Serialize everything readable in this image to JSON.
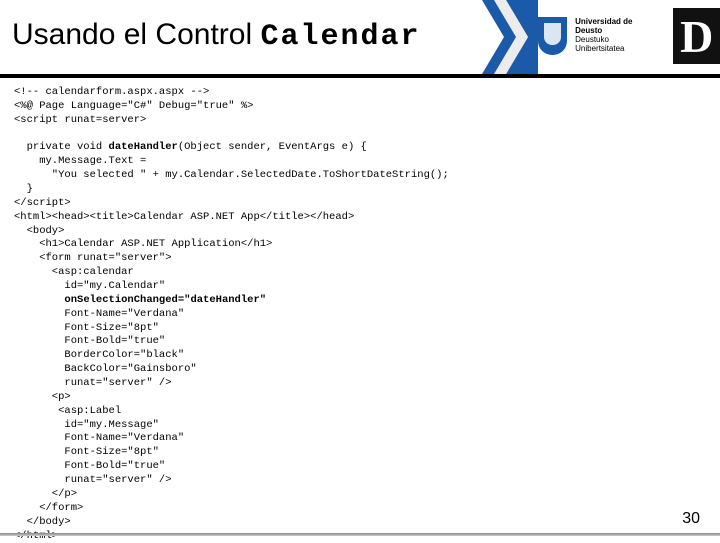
{
  "title_prefix": "Usando el Control ",
  "title_mono": "Calendar",
  "university_line1": "Universidad de Deusto",
  "university_line2": "Deustuko Unibertsitatea",
  "big_d": "D",
  "page_number": "30",
  "code_l01": "<!-- calendarform.aspx.aspx -->",
  "code_l02": "<%@ Page Language=\"C#\" Debug=\"true\" %>",
  "code_l03": "<script runat=server>",
  "code_l04": "  private void ",
  "code_l04b": "dateHandler",
  "code_l04c": "(Object sender, EventArgs e) {",
  "code_l05": "    my.Message.Text =",
  "code_l06": "      \"You selected \" + my.Calendar.SelectedDate.ToShortDateString();",
  "code_l07": "  }",
  "code_l08": "</script>",
  "code_l09": "<html><head><title>Calendar ASP.NET App</title></head>",
  "code_l10": "  <body>",
  "code_l11": "    <h1>Calendar ASP.NET Application</h1>",
  "code_l12": "    <form runat=\"server\">",
  "code_l13": "      <asp:calendar",
  "code_l14": "        id=\"my.Calendar\"",
  "code_l15a": "        ",
  "code_l15b": "onSelectionChanged=\"dateHandler\"",
  "code_l16": "        Font-Name=\"Verdana\"",
  "code_l17": "        Font-Size=\"8pt\"",
  "code_l18": "        Font-Bold=\"true\"",
  "code_l19": "        BorderColor=\"black\"",
  "code_l20": "        BackColor=\"Gainsboro\"",
  "code_l21": "        runat=\"server\" />",
  "code_l22": "      <p>",
  "code_l23": "       <asp:Label",
  "code_l24": "        id=\"my.Message\"",
  "code_l25": "        Font-Name=\"Verdana\"",
  "code_l26": "        Font-Size=\"8pt\"",
  "code_l27": "        Font-Bold=\"true\"",
  "code_l28": "        runat=\"server\" />",
  "code_l29": "      </p>",
  "code_l30": "    </form>",
  "code_l31": "  </body>",
  "code_l32": "</html>"
}
